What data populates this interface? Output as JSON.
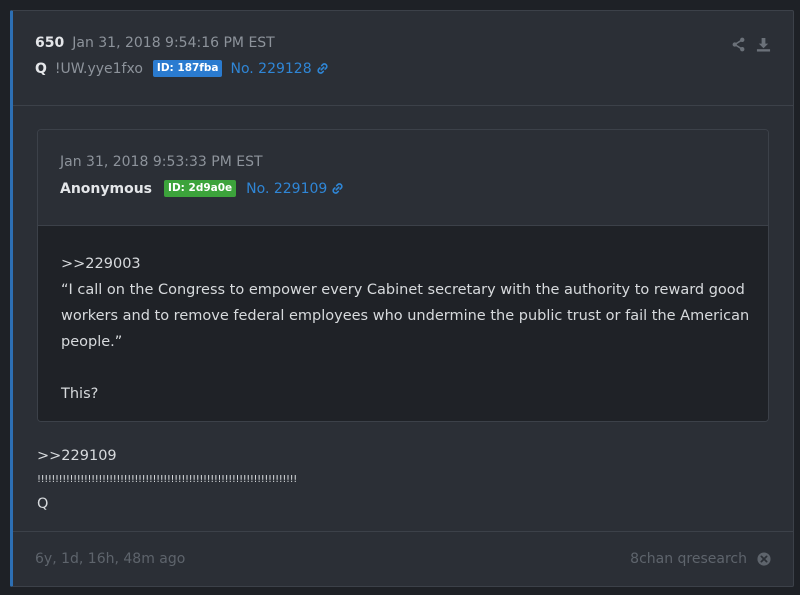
{
  "post": {
    "number": "650",
    "timestamp": "Jan 31, 2018 9:54:16 PM EST",
    "author": "Q",
    "tripcode": "!UW.yye1fxo",
    "id_badge": "ID: 187fba",
    "post_link": "No. 229128"
  },
  "quote": {
    "timestamp": "Jan 31, 2018 9:53:33 PM EST",
    "author": "Anonymous",
    "id_badge": "ID: 2d9a0e",
    "post_link": "No. 229109",
    "body_lines": [
      ">>229003",
      "“I call on the Congress to empower every Cabinet secretary with the authority to reward good",
      "workers and to remove federal employees who undermine the public trust or fail the American",
      "people.”",
      "",
      "This?"
    ]
  },
  "body": {
    "reference": ">>229109",
    "exclamations": "!!!!!!!!!!!!!!!!!!!!!!!!!!!!!!!!!!!!!!!!!!!!!!!!!!!!!!!!!!!!!!!!!!!!!!!!",
    "signature": "Q"
  },
  "footer": {
    "age": "6y, 1d, 16h, 48m ago",
    "source": "8chan qresearch"
  },
  "colors": {
    "accent_link": "#2f86d6",
    "q_id_badge": "#2a7bd0",
    "anon_id_badge": "#3ca33b",
    "card_border_accent": "#2d6fb3"
  },
  "icons": [
    "share-icon",
    "download-icon",
    "link-icon",
    "close-circle-icon"
  ]
}
